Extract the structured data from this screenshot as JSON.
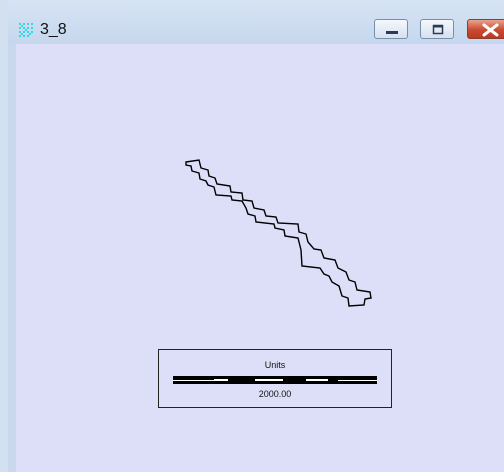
{
  "window": {
    "title": "3_8",
    "icon": "grid-map-icon",
    "controls": {
      "minimize": "minimize-icon",
      "maximize": "maximize-icon",
      "close": "close-icon"
    }
  },
  "scale_bar": {
    "units_label": "Units",
    "value_label": "2000.00"
  },
  "colors": {
    "titlebar": "#c6d7ed",
    "canvas": "#dddff9",
    "outline": "#000000",
    "close_button": "#c94a31",
    "app_icon": "#2fd9e8"
  }
}
